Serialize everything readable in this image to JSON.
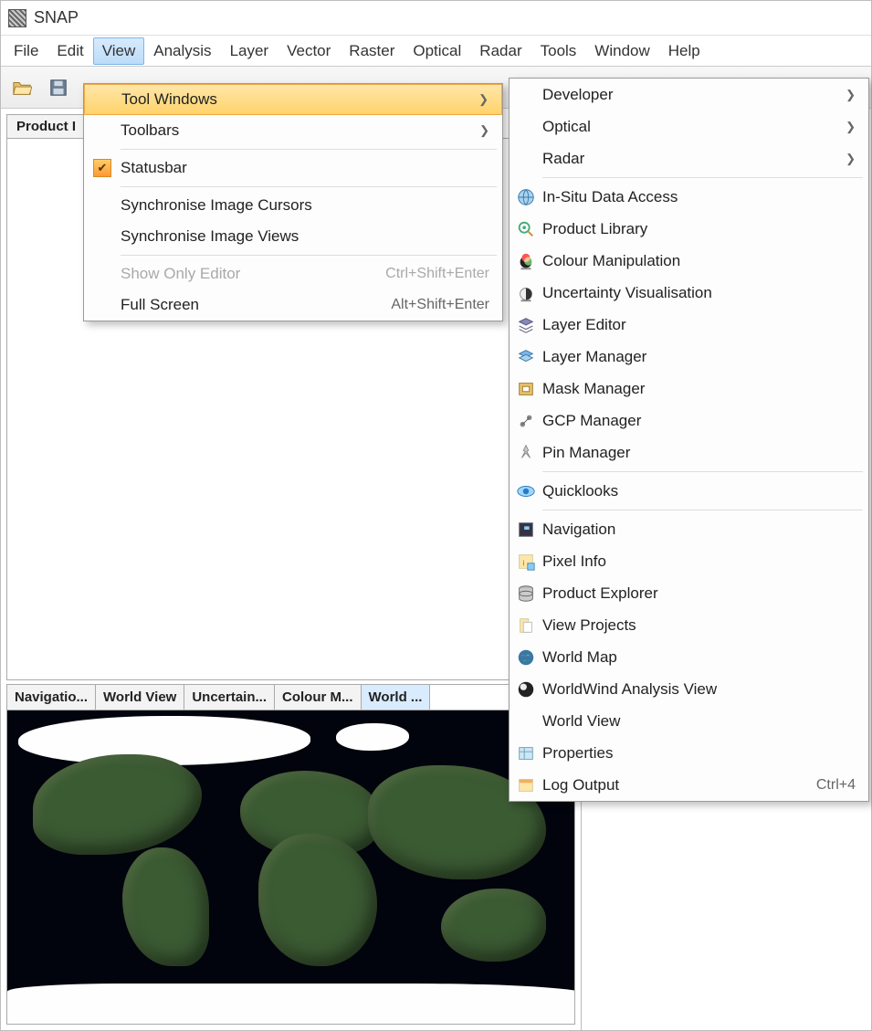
{
  "app": {
    "title": "SNAP"
  },
  "menubar": [
    "File",
    "Edit",
    "View",
    "Analysis",
    "Layer",
    "Vector",
    "Raster",
    "Optical",
    "Radar",
    "Tools",
    "Window",
    "Help"
  ],
  "menubar_active_index": 2,
  "panel": {
    "product_explorer_tab": "Product I"
  },
  "bottom_tabs": [
    "Navigatio...",
    "World View",
    "Uncertain...",
    "Colour M...",
    "World ..."
  ],
  "bottom_tab_active_index": 4,
  "view_menu": {
    "items": [
      {
        "label": "Tool Windows",
        "submenu": true,
        "highlight": true
      },
      {
        "label": "Toolbars",
        "submenu": true
      },
      {
        "sep": true
      },
      {
        "label": "Statusbar",
        "checked": true
      },
      {
        "sep": true
      },
      {
        "label": "Synchronise Image Cursors"
      },
      {
        "label": "Synchronise Image Views"
      },
      {
        "sep": true
      },
      {
        "label": "Show Only Editor",
        "accel": "Ctrl+Shift+Enter",
        "disabled": true
      },
      {
        "label": "Full Screen",
        "accel": "Alt+Shift+Enter"
      }
    ]
  },
  "tool_windows_menu": {
    "items": [
      {
        "label": "Developer",
        "submenu": true
      },
      {
        "label": "Optical",
        "submenu": true
      },
      {
        "label": "Radar",
        "submenu": true
      },
      {
        "sep": true
      },
      {
        "label": "In-Situ Data Access",
        "icon": "globe-icon"
      },
      {
        "label": "Product Library",
        "icon": "library-icon"
      },
      {
        "label": "Colour Manipulation",
        "icon": "colour-icon"
      },
      {
        "label": "Uncertainty Visualisation",
        "icon": "uncertainty-icon"
      },
      {
        "label": "Layer Editor",
        "icon": "layer-editor-icon"
      },
      {
        "label": "Layer Manager",
        "icon": "layer-manager-icon"
      },
      {
        "label": "Mask Manager",
        "icon": "mask-icon"
      },
      {
        "label": "GCP Manager",
        "icon": "gcp-icon"
      },
      {
        "label": "Pin Manager",
        "icon": "pin-icon"
      },
      {
        "sep": true
      },
      {
        "label": "Quicklooks",
        "icon": "eye-icon"
      },
      {
        "sep": true
      },
      {
        "label": "Navigation",
        "icon": "navigation-icon"
      },
      {
        "label": "Pixel Info",
        "icon": "pixel-info-icon"
      },
      {
        "label": "Product Explorer",
        "icon": "database-icon"
      },
      {
        "label": "View Projects",
        "icon": "projects-icon"
      },
      {
        "label": "World Map",
        "icon": "world-map-icon"
      },
      {
        "label": "WorldWind Analysis View",
        "icon": "worldwind-icon"
      },
      {
        "label": "World View"
      },
      {
        "label": "Properties",
        "icon": "properties-icon"
      },
      {
        "label": "Log Output",
        "icon": "log-icon",
        "accel": "Ctrl+4"
      }
    ]
  }
}
